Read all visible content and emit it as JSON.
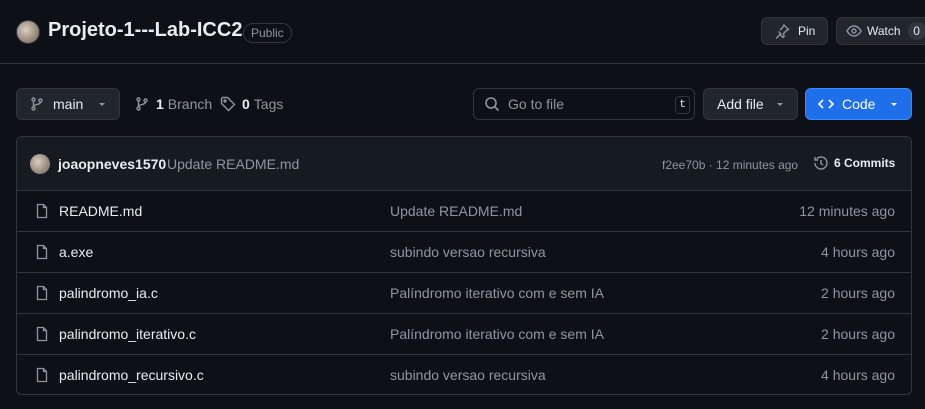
{
  "repo": {
    "title": "Projeto-1---Lab-ICC2",
    "visibility": "Public",
    "pin_label": "Pin",
    "watch_label": "Watch",
    "watch_count": "0"
  },
  "toolbar": {
    "branch": "main",
    "branch_count": "1",
    "branch_label": "Branch",
    "tag_count": "0",
    "tag_label": "Tags",
    "search_placeholder": "Go to file",
    "search_shortcut": "t",
    "add_file_label": "Add file",
    "code_label": "Code"
  },
  "latest_commit": {
    "author": "joaopneves1570",
    "message": "Update README.md",
    "hash_time": "f2ee70b · 12 minutes ago",
    "commits_label": "6 Commits"
  },
  "files": [
    {
      "name": "README.md",
      "message": "Update README.md",
      "time": "12 minutes ago"
    },
    {
      "name": "a.exe",
      "message": "subindo versao recursiva",
      "time": "4 hours ago"
    },
    {
      "name": "palindromo_ia.c",
      "message": "Palíndromo iterativo com e sem IA",
      "time": "2 hours ago"
    },
    {
      "name": "palindromo_iterativo.c",
      "message": "Palíndromo iterativo com e sem IA",
      "time": "2 hours ago"
    },
    {
      "name": "palindromo_recursivo.c",
      "message": "subindo versao recursiva",
      "time": "4 hours ago"
    }
  ],
  "colors": {
    "background": "#0d1117",
    "accent": "#1f6feb",
    "border": "#30363d",
    "muted_text": "#8d96a0"
  },
  "icons": [
    "pin-icon",
    "eye-icon",
    "branch-icon",
    "tag-icon",
    "search-icon",
    "code-icon",
    "history-icon",
    "file-icon",
    "caret-down-icon"
  ]
}
